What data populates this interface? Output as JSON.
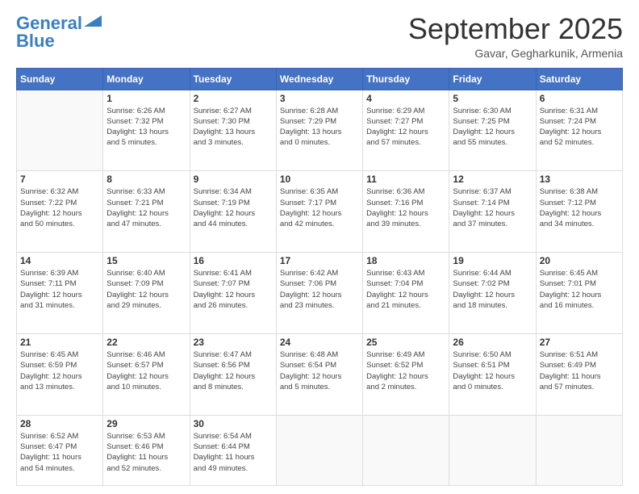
{
  "logo": {
    "line1": "General",
    "line2": "Blue"
  },
  "title": "September 2025",
  "location": "Gavar, Gegharkunik, Armenia",
  "days_of_week": [
    "Sunday",
    "Monday",
    "Tuesday",
    "Wednesday",
    "Thursday",
    "Friday",
    "Saturday"
  ],
  "weeks": [
    [
      {
        "day": "",
        "info": ""
      },
      {
        "day": "1",
        "info": "Sunrise: 6:26 AM\nSunset: 7:32 PM\nDaylight: 13 hours\nand 5 minutes."
      },
      {
        "day": "2",
        "info": "Sunrise: 6:27 AM\nSunset: 7:30 PM\nDaylight: 13 hours\nand 3 minutes."
      },
      {
        "day": "3",
        "info": "Sunrise: 6:28 AM\nSunset: 7:29 PM\nDaylight: 13 hours\nand 0 minutes."
      },
      {
        "day": "4",
        "info": "Sunrise: 6:29 AM\nSunset: 7:27 PM\nDaylight: 12 hours\nand 57 minutes."
      },
      {
        "day": "5",
        "info": "Sunrise: 6:30 AM\nSunset: 7:25 PM\nDaylight: 12 hours\nand 55 minutes."
      },
      {
        "day": "6",
        "info": "Sunrise: 6:31 AM\nSunset: 7:24 PM\nDaylight: 12 hours\nand 52 minutes."
      }
    ],
    [
      {
        "day": "7",
        "info": "Sunrise: 6:32 AM\nSunset: 7:22 PM\nDaylight: 12 hours\nand 50 minutes."
      },
      {
        "day": "8",
        "info": "Sunrise: 6:33 AM\nSunset: 7:21 PM\nDaylight: 12 hours\nand 47 minutes."
      },
      {
        "day": "9",
        "info": "Sunrise: 6:34 AM\nSunset: 7:19 PM\nDaylight: 12 hours\nand 44 minutes."
      },
      {
        "day": "10",
        "info": "Sunrise: 6:35 AM\nSunset: 7:17 PM\nDaylight: 12 hours\nand 42 minutes."
      },
      {
        "day": "11",
        "info": "Sunrise: 6:36 AM\nSunset: 7:16 PM\nDaylight: 12 hours\nand 39 minutes."
      },
      {
        "day": "12",
        "info": "Sunrise: 6:37 AM\nSunset: 7:14 PM\nDaylight: 12 hours\nand 37 minutes."
      },
      {
        "day": "13",
        "info": "Sunrise: 6:38 AM\nSunset: 7:12 PM\nDaylight: 12 hours\nand 34 minutes."
      }
    ],
    [
      {
        "day": "14",
        "info": "Sunrise: 6:39 AM\nSunset: 7:11 PM\nDaylight: 12 hours\nand 31 minutes."
      },
      {
        "day": "15",
        "info": "Sunrise: 6:40 AM\nSunset: 7:09 PM\nDaylight: 12 hours\nand 29 minutes."
      },
      {
        "day": "16",
        "info": "Sunrise: 6:41 AM\nSunset: 7:07 PM\nDaylight: 12 hours\nand 26 minutes."
      },
      {
        "day": "17",
        "info": "Sunrise: 6:42 AM\nSunset: 7:06 PM\nDaylight: 12 hours\nand 23 minutes."
      },
      {
        "day": "18",
        "info": "Sunrise: 6:43 AM\nSunset: 7:04 PM\nDaylight: 12 hours\nand 21 minutes."
      },
      {
        "day": "19",
        "info": "Sunrise: 6:44 AM\nSunset: 7:02 PM\nDaylight: 12 hours\nand 18 minutes."
      },
      {
        "day": "20",
        "info": "Sunrise: 6:45 AM\nSunset: 7:01 PM\nDaylight: 12 hours\nand 16 minutes."
      }
    ],
    [
      {
        "day": "21",
        "info": "Sunrise: 6:45 AM\nSunset: 6:59 PM\nDaylight: 12 hours\nand 13 minutes."
      },
      {
        "day": "22",
        "info": "Sunrise: 6:46 AM\nSunset: 6:57 PM\nDaylight: 12 hours\nand 10 minutes."
      },
      {
        "day": "23",
        "info": "Sunrise: 6:47 AM\nSunset: 6:56 PM\nDaylight: 12 hours\nand 8 minutes."
      },
      {
        "day": "24",
        "info": "Sunrise: 6:48 AM\nSunset: 6:54 PM\nDaylight: 12 hours\nand 5 minutes."
      },
      {
        "day": "25",
        "info": "Sunrise: 6:49 AM\nSunset: 6:52 PM\nDaylight: 12 hours\nand 2 minutes."
      },
      {
        "day": "26",
        "info": "Sunrise: 6:50 AM\nSunset: 6:51 PM\nDaylight: 12 hours\nand 0 minutes."
      },
      {
        "day": "27",
        "info": "Sunrise: 6:51 AM\nSunset: 6:49 PM\nDaylight: 11 hours\nand 57 minutes."
      }
    ],
    [
      {
        "day": "28",
        "info": "Sunrise: 6:52 AM\nSunset: 6:47 PM\nDaylight: 11 hours\nand 54 minutes."
      },
      {
        "day": "29",
        "info": "Sunrise: 6:53 AM\nSunset: 6:46 PM\nDaylight: 11 hours\nand 52 minutes."
      },
      {
        "day": "30",
        "info": "Sunrise: 6:54 AM\nSunset: 6:44 PM\nDaylight: 11 hours\nand 49 minutes."
      },
      {
        "day": "",
        "info": ""
      },
      {
        "day": "",
        "info": ""
      },
      {
        "day": "",
        "info": ""
      },
      {
        "day": "",
        "info": ""
      }
    ]
  ]
}
